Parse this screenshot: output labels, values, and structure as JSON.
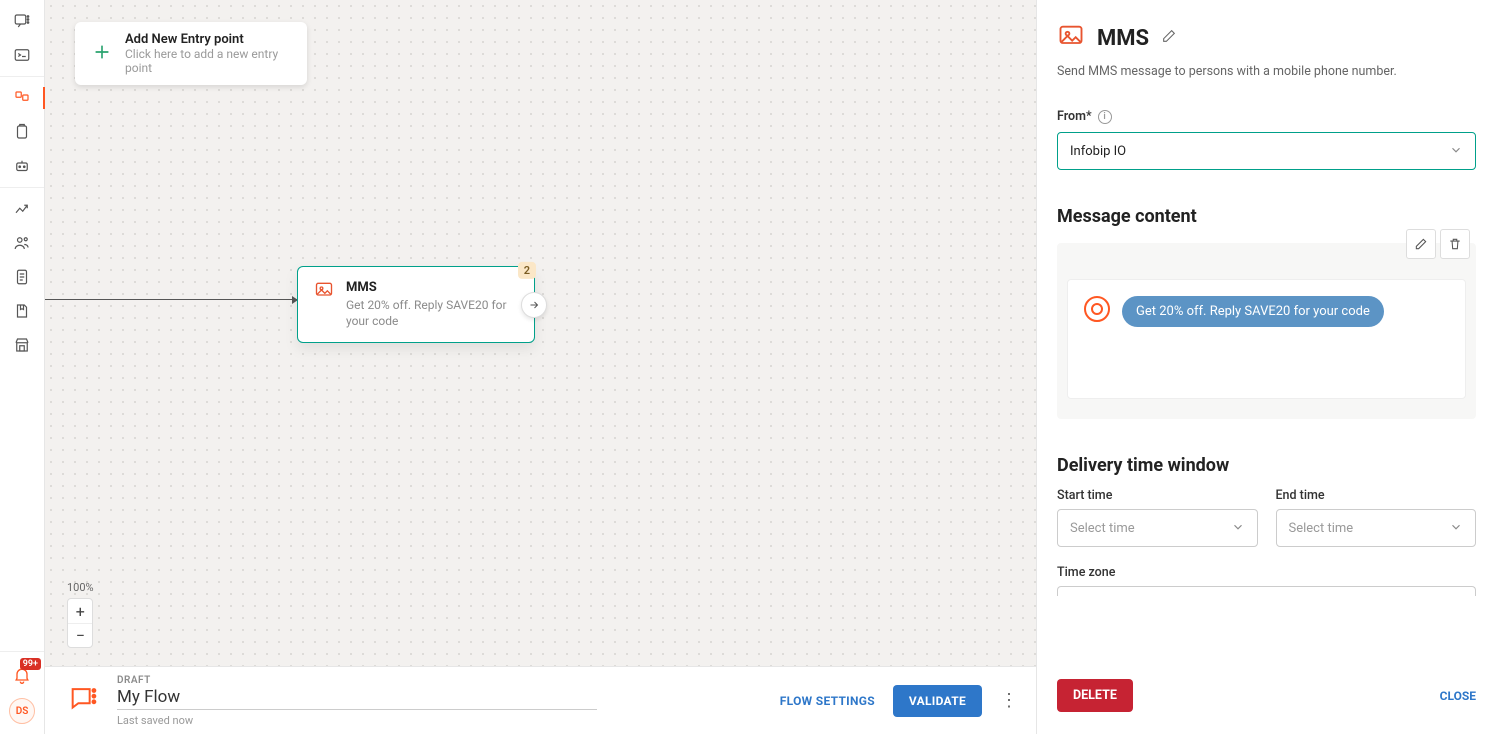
{
  "sidebar": {
    "notif_badge": "99+",
    "avatar": "DS"
  },
  "canvas": {
    "entry": {
      "title": "Add New Entry point",
      "subtitle": "Click here to add a new entry point"
    },
    "node": {
      "badge": "2",
      "title": "MMS",
      "subtitle": "Get 20% off. Reply SAVE20 for your code"
    },
    "zoom": "100%"
  },
  "footer": {
    "status": "DRAFT",
    "flow_name": "My Flow",
    "saved": "Last saved now",
    "flow_settings": "FLOW SETTINGS",
    "validate": "VALIDATE"
  },
  "panel": {
    "title": "MMS",
    "desc": "Send MMS message to persons with a mobile phone number.",
    "from_label": "From*",
    "from_value": "Infobip IO",
    "msg_section": "Message content",
    "msg_body": "Get 20% off. Reply SAVE20 for your code",
    "delivery_section": "Delivery time window",
    "start_label": "Start time",
    "end_label": "End time",
    "time_ph": "Select time",
    "tz_label": "Time zone",
    "delete": "DELETE",
    "close": "CLOSE"
  }
}
